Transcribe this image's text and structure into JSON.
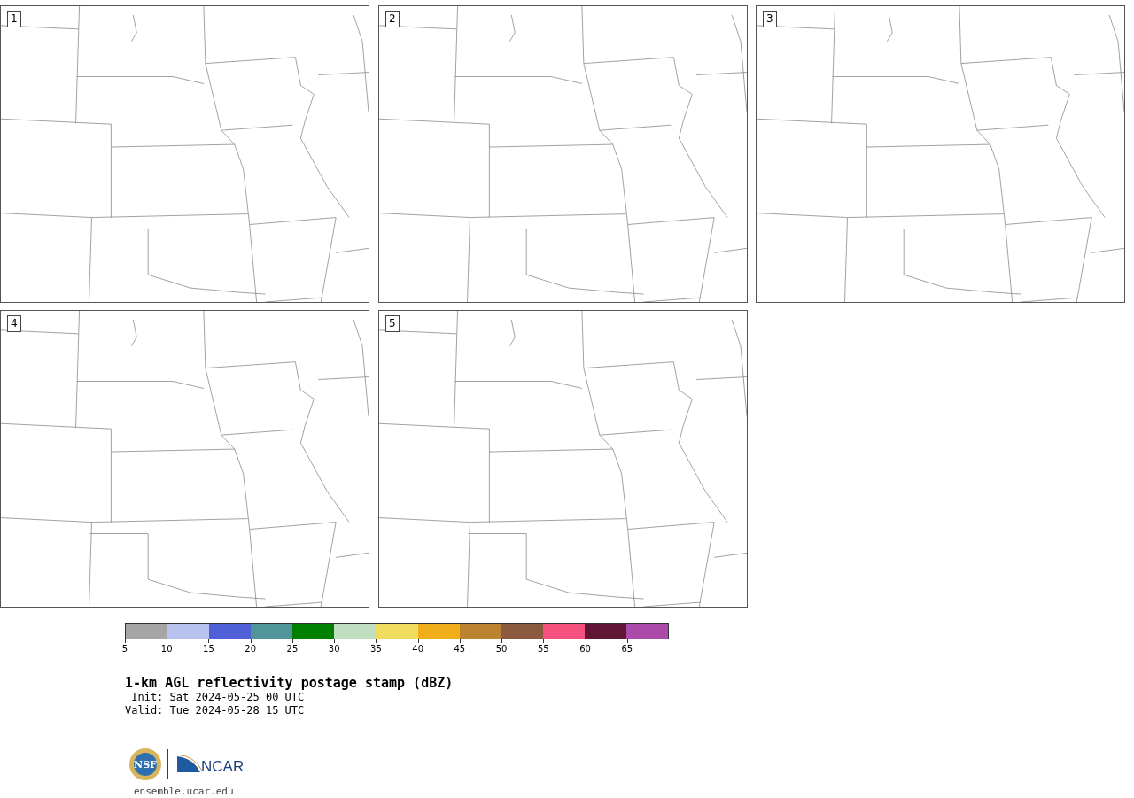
{
  "panels": [
    {
      "label": "1"
    },
    {
      "label": "2"
    },
    {
      "label": "3"
    },
    {
      "label": "4"
    },
    {
      "label": "5"
    }
  ],
  "colorbar": {
    "colors": [
      {
        "color": "#a5a5a5"
      },
      {
        "color": "#b7c3ee"
      },
      {
        "color": "#5060d6"
      },
      {
        "color": "#4f9599"
      },
      {
        "color": "#008000"
      },
      {
        "color": "#c0dfc0"
      },
      {
        "color": "#f0dc5e"
      },
      {
        "color": "#f0ae1a"
      },
      {
        "color": "#bb8330"
      },
      {
        "color": "#8b5a3f"
      },
      {
        "color": "#f5507e"
      },
      {
        "color": "#621636"
      },
      {
        "color": "#ab4aa8"
      }
    ],
    "ticks": [
      "5",
      "10",
      "15",
      "20",
      "25",
      "30",
      "35",
      "40",
      "45",
      "50",
      "55",
      "60",
      "65"
    ]
  },
  "title": "1-km AGL reflectivity postage stamp (dBZ)",
  "info_lines": [
    "Init: Sat 2024-05-25 00 UTC",
    "Valid: Tue 2024-05-28 15 UTC"
  ],
  "logos": {
    "nsf": "NSF",
    "ncar": "NCAR"
  },
  "url": "ensemble.ucar.edu"
}
